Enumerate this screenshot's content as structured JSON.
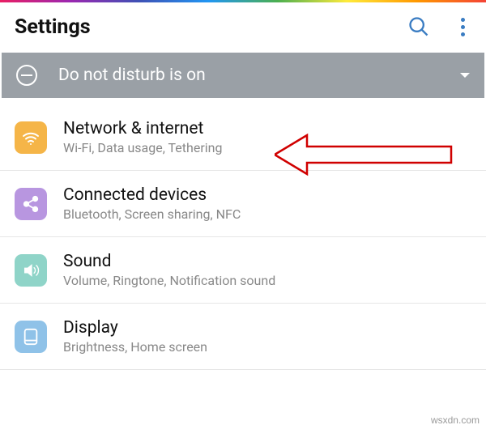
{
  "header": {
    "title": "Settings"
  },
  "dnd": {
    "text": "Do not disturb is on"
  },
  "items": [
    {
      "title": "Network & internet",
      "subtitle": "Wi-Fi, Data usage, Tethering"
    },
    {
      "title": "Connected devices",
      "subtitle": "Bluetooth, Screen sharing, NFC"
    },
    {
      "title": "Sound",
      "subtitle": "Volume, Ringtone, Notification sound"
    },
    {
      "title": "Display",
      "subtitle": "Brightness, Home screen"
    }
  ],
  "watermark": "wsxdn.com"
}
